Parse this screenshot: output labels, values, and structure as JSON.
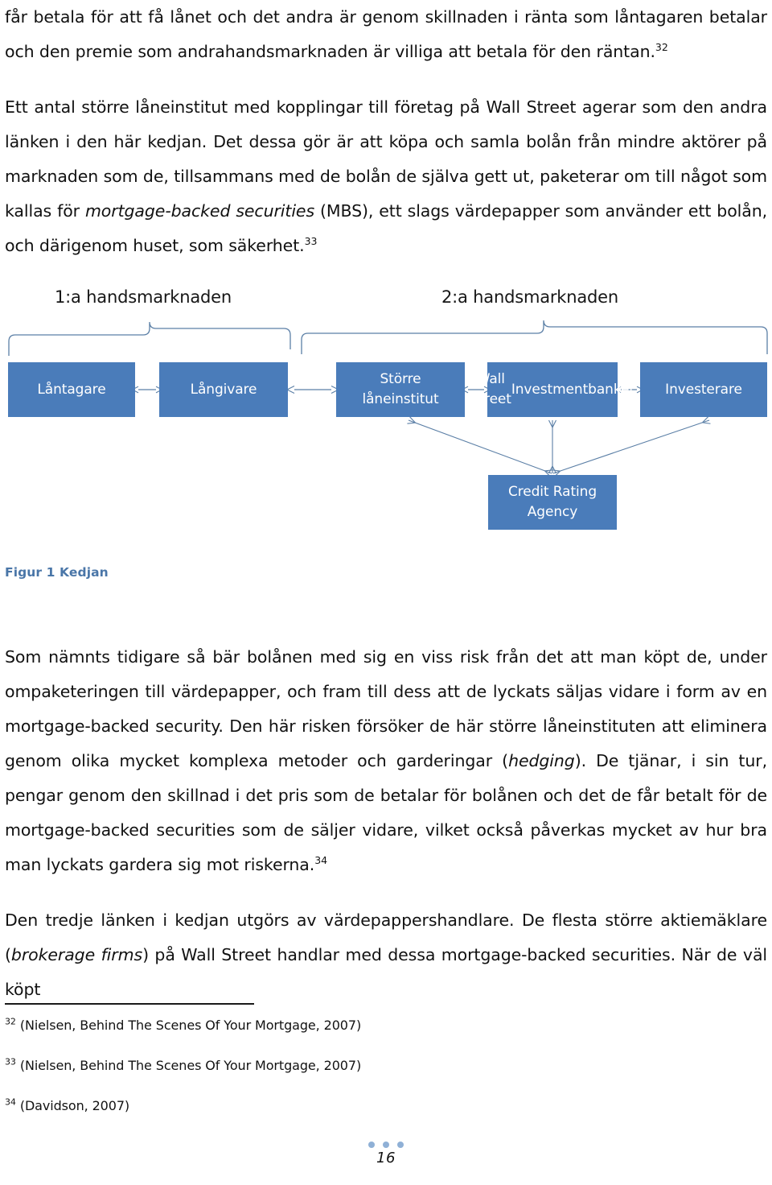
{
  "document": {
    "page_number": "16",
    "footer_dots": 3
  },
  "body": {
    "paragraph_1": {
      "text": "får betala för att få lånet och det andra är genom skillnaden i ränta som låntagaren betalar och den premie som andrahandsmarknaden är villiga att betala för den räntan.",
      "footnote_ref": "32"
    },
    "paragraph_2": {
      "part_1": "Ett antal större låneinstitut med kopplingar till företag på Wall Street agerar som den andra länken i den här kedjan. Det dessa gör är att köpa och samla bolån från mindre aktörer på marknaden som de, tillsammans med de bolån de själva gett ut, paketerar om till något som kallas för ",
      "italic_1": "mortgage-backed securities",
      "part_2": " (MBS), ett slags värdepapper som använder ett bolån, och därigenom huset, som säkerhet.",
      "footnote_ref": "33"
    },
    "paragraph_3": {
      "part_1": "Som nämnts tidigare så bär bolånen med sig en viss risk från det att man köpt de, under ompaketeringen till värdepapper, och fram till dess att de lyckats säljas vidare i form av en mortgage-backed security. Den här risken försöker de här större låneinstituten att eliminera genom olika mycket komplexa metoder och garderingar (",
      "italic_1": "hedging",
      "part_2": "). De tjänar, i sin tur, pengar genom den skillnad i det pris som de betalar för bolånen och det de får betalt för de mortgage-backed securities som de säljer vidare, vilket också påverkas mycket av hur bra man lyckats gardera sig mot riskerna.",
      "footnote_ref": "34"
    },
    "paragraph_4": {
      "part_1": "Den tredje länken i kedjan utgörs av värdepappershandlare. De flesta större aktiemäklare (",
      "italic_1": "brokerage firms",
      "part_2": ") på Wall Street handlar med dessa mortgage-backed securities. När de väl köpt"
    }
  },
  "figure": {
    "caption": "Figur 1 Kedjan",
    "brace_labels": {
      "first": "1:a handsmarknaden",
      "second": "2:a handsmarknaden"
    },
    "nodes": [
      {
        "id": "lantagare",
        "label": "Låntagare"
      },
      {
        "id": "langivare",
        "label": "Långivare"
      },
      {
        "id": "storre-laneinstitut",
        "label": "Större låneinstitut"
      },
      {
        "id": "wall-street-investmentbanker",
        "line1": "Wall Street",
        "line2": "Investmentbanker"
      },
      {
        "id": "investerare",
        "label": "Investerare"
      },
      {
        "id": "credit-rating-agency",
        "line1": "Credit Rating",
        "line2": "Agency"
      }
    ],
    "colors": {
      "node_fill": "#4a7cba",
      "node_text": "#ffffff",
      "connector": "#5b7fa6",
      "caption": "#4a76a8"
    }
  },
  "footnotes": [
    {
      "number": "32",
      "text": "(Nielsen, Behind The Scenes Of Your Mortgage, 2007)"
    },
    {
      "number": "33",
      "text": "(Nielsen, Behind The Scenes Of Your Mortgage, 2007)"
    },
    {
      "number": "34",
      "text": "(Davidson, 2007)"
    }
  ]
}
